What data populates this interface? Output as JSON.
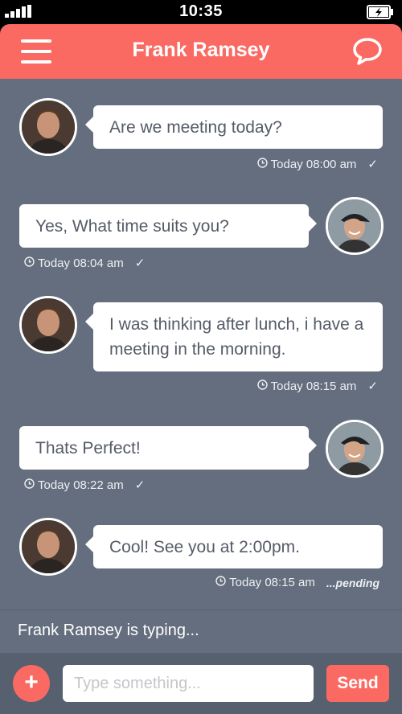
{
  "status_bar": {
    "time": "10:35"
  },
  "header": {
    "title": "Frank Ramsey",
    "menu_icon": "hamburger-menu-icon",
    "chat_icon": "chat-bubble-icon"
  },
  "messages": [
    {
      "side": "left",
      "sender": "Frank Ramsey",
      "text": "Are we meeting today?",
      "time": "Today 08:00 am",
      "status": "read"
    },
    {
      "side": "right",
      "sender": "me",
      "text": "Yes, What time suits you?",
      "time": "Today 08:04 am",
      "status": "read"
    },
    {
      "side": "left",
      "sender": "Frank Ramsey",
      "text": "I was thinking after lunch, i have a meeting in the morning.",
      "time": "Today 08:15 am",
      "status": "read"
    },
    {
      "side": "right",
      "sender": "me",
      "text": "Thats Perfect!",
      "time": "Today 08:22 am",
      "status": "read"
    },
    {
      "side": "left",
      "sender": "Frank Ramsey",
      "text": "Cool! See you at 2:00pm.",
      "time": "Today 08:15 am",
      "status": "pending",
      "status_label": "...pending"
    }
  ],
  "typing_indicator": "Frank Ramsey is typing...",
  "composer": {
    "placeholder": "Type something...",
    "value": "",
    "send_label": "Send",
    "add_label": "+"
  },
  "colors": {
    "accent": "#fa6a62",
    "background": "#646e7e",
    "bubble": "#ffffff",
    "bubble_text": "#555b66"
  }
}
